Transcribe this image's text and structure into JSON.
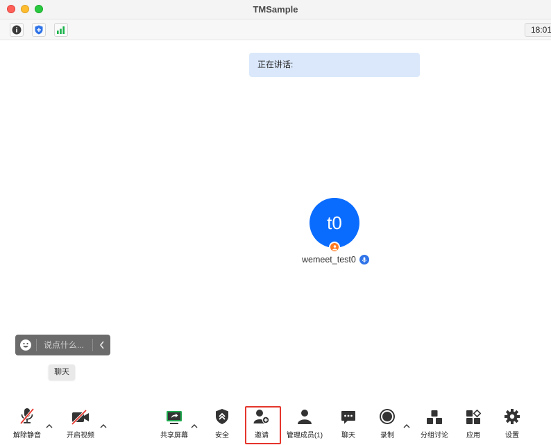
{
  "window": {
    "title": "TMSample",
    "controls": [
      "close",
      "minimize",
      "maximize"
    ]
  },
  "infobar": {
    "buttons": [
      {
        "name": "meeting-info",
        "icon": "info-icon"
      },
      {
        "name": "security-shield",
        "icon": "shield-icon",
        "color": "#2f73e8"
      },
      {
        "name": "network-signal",
        "icon": "signal-bars-icon",
        "color": "#18b24a"
      }
    ],
    "clock": "18:01"
  },
  "speaking": {
    "label": "正在讲话:"
  },
  "participant": {
    "avatar_text": "t0",
    "name": "wemeet_test0",
    "avatar_color": "#0a6cff",
    "host_badge_color": "#ff7b22"
  },
  "chat": {
    "placeholder": "说点什么...",
    "tooltip": "聊天"
  },
  "toolbar": {
    "items": [
      {
        "label": "解除静音",
        "icon": "mic-muted-icon",
        "has_menu": true
      },
      {
        "label": "开启视频",
        "icon": "video-off-icon",
        "has_menu": true
      },
      {
        "label": "共享屏幕",
        "icon": "share-screen-icon",
        "has_menu": true
      },
      {
        "label": "安全",
        "icon": "shield-icon",
        "has_menu": false
      },
      {
        "label": "邀请",
        "icon": "invite-user-icon",
        "has_menu": false,
        "highlighted": true
      },
      {
        "label": "管理成员(1)",
        "icon": "members-icon",
        "has_menu": false
      },
      {
        "label": "聊天",
        "icon": "chat-icon",
        "has_menu": false
      },
      {
        "label": "录制",
        "icon": "record-icon",
        "has_menu": true
      },
      {
        "label": "分组讨论",
        "icon": "breakout-rooms-icon",
        "has_menu": false
      },
      {
        "label": "应用",
        "icon": "apps-icon",
        "has_menu": false
      },
      {
        "label": "设置",
        "icon": "gear-icon",
        "has_menu": false
      }
    ],
    "highlight_color": "#e5352c"
  }
}
